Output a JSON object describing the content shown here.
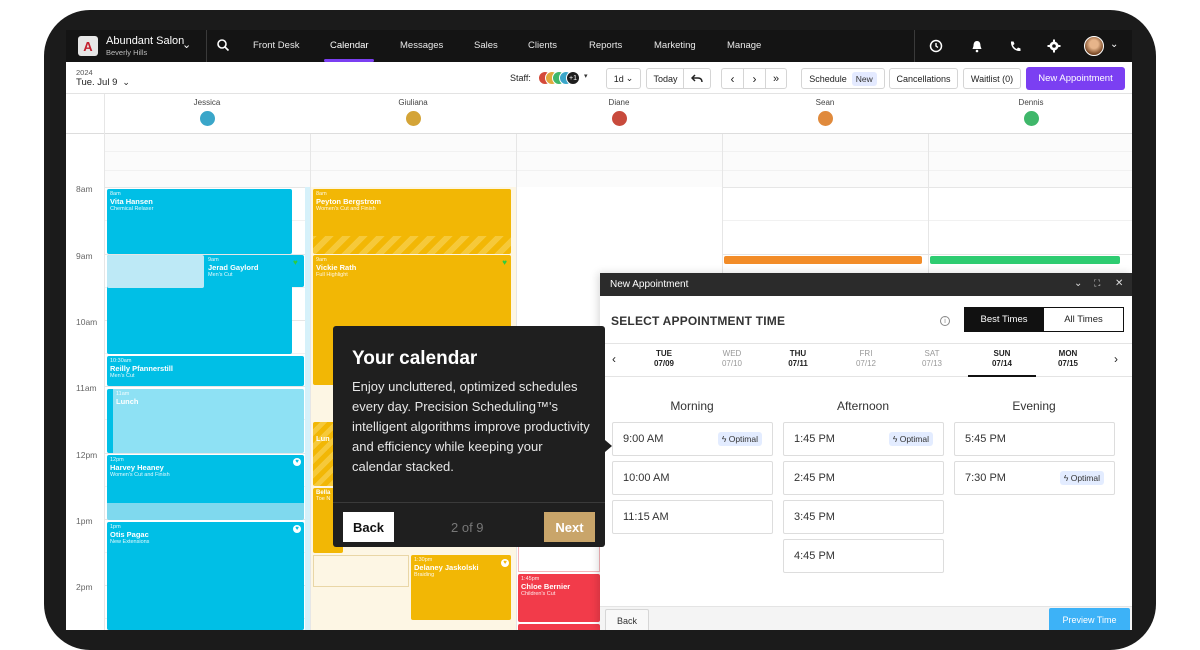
{
  "brand": {
    "name": "Abundant Salon",
    "location": "Beverly Hills",
    "logo_letter": "A"
  },
  "nav": {
    "items": [
      "Front Desk",
      "Calendar",
      "Messages",
      "Sales",
      "Clients",
      "Reports",
      "Marketing",
      "Manage"
    ],
    "active": "Calendar",
    "accent": "#7b3ff2"
  },
  "toolbar": {
    "year": "2024",
    "date": "Tue. Jul 9",
    "staff_label": "Staff:",
    "staff_more": "+1",
    "view": "1d",
    "today": "Today",
    "schedule": "Schedule",
    "schedule_tag": "New",
    "cancellations": "Cancellations",
    "waitlist": "Waitlist (0)",
    "new_appointment": "New Appointment"
  },
  "staff": [
    {
      "name": "Jessica",
      "color": "#3aa6c9"
    },
    {
      "name": "Giuliana",
      "color": "#d4a437"
    },
    {
      "name": "Diane",
      "color": "#c84a3c"
    },
    {
      "name": "Sean",
      "color": "#e08a3c"
    },
    {
      "name": "Dennis",
      "color": "#3fb76a"
    }
  ],
  "times": [
    "8am",
    "9am",
    "10am",
    "11am",
    "12pm",
    "1pm",
    "2pm"
  ],
  "appointments": [
    {
      "time": "8am",
      "name": "Vita Hansen",
      "service": "Chemical Relaxer"
    },
    {
      "time": "8am",
      "name": "Peyton Bergstrom",
      "service": "Women's Cut and Finish"
    },
    {
      "time": "9am",
      "name": "Jerad Gaylord",
      "service": "Men's Cut"
    },
    {
      "time": "9am",
      "name": "Vickie Rath",
      "service": "Full Highlight"
    },
    {
      "time": "10:30am",
      "name": "Reilly Pfannerstill",
      "service": "Men's Cut"
    },
    {
      "time": "11am",
      "name": "Lunch",
      "service": ""
    },
    {
      "time": "12pm",
      "name": "Harvey Heaney",
      "service": "Women's Cut and Finish"
    },
    {
      "time": "1pm",
      "name": "Otis Pagac",
      "service": "New Extensions"
    },
    {
      "time": "1:30pm",
      "name": "Delaney Jaskolski",
      "service": "Braiding"
    },
    {
      "time": "1:45pm",
      "name": "Chloe Bernier",
      "service": "Children's Cut"
    }
  ],
  "partial_labels": {
    "giuliana_mid": "Lun",
    "giuliana_b": "Bella",
    "giuliana_b2": "Toe N"
  },
  "tour": {
    "title": "Your calendar",
    "body": "Enjoy uncluttered, optimized schedules every day. Precision Scheduling™'s intelligent algorithms improve productivity and efficiency while keeping your calendar stacked.",
    "back": "Back",
    "step": "2 of 9",
    "next": "Next"
  },
  "panel": {
    "title": "New Appointment",
    "heading": "SELECT APPOINTMENT TIME",
    "best_times": "Best Times",
    "all_times": "All Times",
    "days": [
      {
        "name": "TUE",
        "date": "07/09",
        "bold": true
      },
      {
        "name": "WED",
        "date": "07/10",
        "bold": false
      },
      {
        "name": "THU",
        "date": "07/11",
        "bold": true
      },
      {
        "name": "FRI",
        "date": "07/12",
        "bold": false
      },
      {
        "name": "SAT",
        "date": "07/13",
        "bold": false
      },
      {
        "name": "SUN",
        "date": "07/14",
        "bold": true
      },
      {
        "name": "MON",
        "date": "07/15",
        "bold": true
      }
    ],
    "selected_day": "SUN",
    "periods": [
      "Morning",
      "Afternoon",
      "Evening"
    ],
    "optimal_label": "Optimal",
    "slots": {
      "morning": [
        {
          "time": "9:00 AM",
          "optimal": true
        },
        {
          "time": "10:00 AM",
          "optimal": false
        },
        {
          "time": "11:15 AM",
          "optimal": false
        }
      ],
      "afternoon": [
        {
          "time": "1:45 PM",
          "optimal": true
        },
        {
          "time": "2:45 PM",
          "optimal": false
        },
        {
          "time": "3:45 PM",
          "optimal": false
        },
        {
          "time": "4:45 PM",
          "optimal": false
        }
      ],
      "evening": [
        {
          "time": "5:45 PM",
          "optimal": false
        },
        {
          "time": "7:30 PM",
          "optimal": true
        }
      ]
    },
    "back": "Back",
    "preview": "Preview Time"
  }
}
